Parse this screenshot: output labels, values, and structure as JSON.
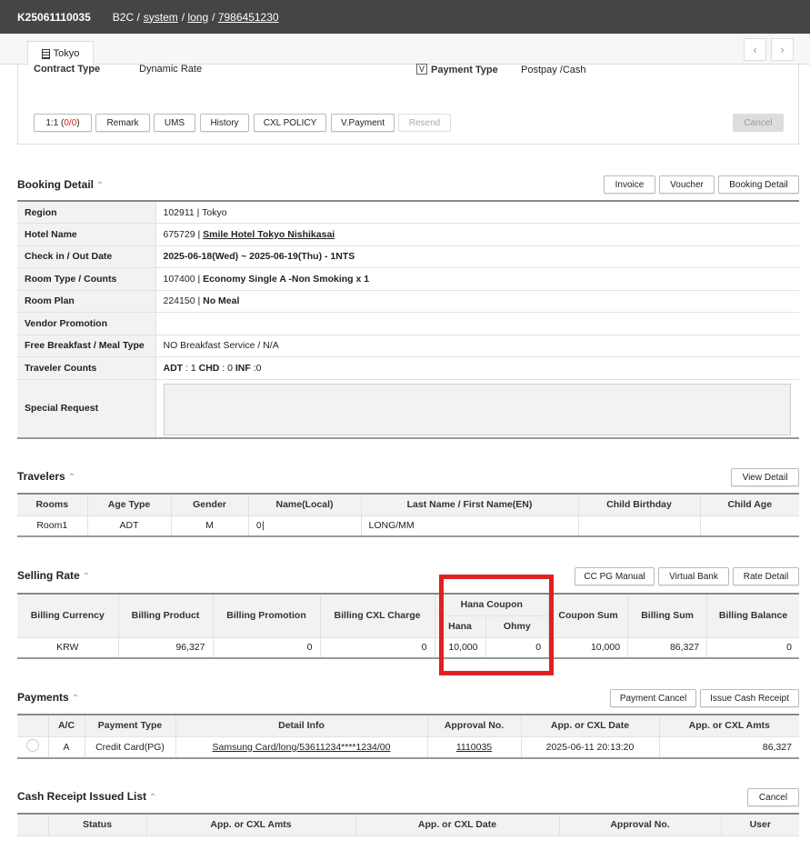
{
  "header": {
    "booking_id": "K25061110035",
    "channel": "B2C /",
    "crumbs": [
      "system",
      "long",
      "7986451230"
    ]
  },
  "tab": {
    "label": "Tokyo",
    "icon": "building-icon"
  },
  "nav": {
    "prev": "‹",
    "next": "›"
  },
  "contract": {
    "contract_type_label": "Contract Type",
    "contract_type": "Dynamic Rate",
    "v_badge": "V",
    "payment_type_label": "Payment Type",
    "payment_type": "Postpay /Cash"
  },
  "actions": {
    "one_to_one": "1:1 (",
    "oto_count": "0/0",
    "oto_close": ")",
    "remark": "Remark",
    "ums": "UMS",
    "history": "History",
    "cxl_policy": "CXL POLICY",
    "v_payment": "V.Payment",
    "resend": "Resend",
    "cancel": "Cancel"
  },
  "booking_detail": {
    "title": "Booking Detail",
    "buttons": [
      "Invoice",
      "Voucher",
      "Booking Detail"
    ],
    "rows": [
      {
        "label": "Region",
        "code": "102911 | ",
        "value": "Tokyo",
        "bold": false
      },
      {
        "label": "Hotel Name",
        "code": "675729 | ",
        "value": "Smile Hotel Tokyo Nishikasai",
        "bold": true
      },
      {
        "label": "Check in / Out Date",
        "code": "",
        "value": "2025-06-18(Wed) ~ 2025-06-19(Thu) - 1NTS",
        "bold": true
      },
      {
        "label": "Room Type / Counts",
        "code": "107400 | ",
        "value": "Economy Single A -Non Smoking x 1",
        "bold": true
      },
      {
        "label": "Room Plan",
        "code": "224150 | ",
        "value": "No Meal",
        "bold": true
      },
      {
        "label": "Vendor Promotion",
        "code": "",
        "value": "",
        "bold": false
      },
      {
        "label": "Free Breakfast / Meal Type",
        "code": "",
        "value": "NO Breakfast Service / N/A",
        "bold": false
      }
    ],
    "traveler_counts_label": "Traveler Counts",
    "adt_label": "ADT",
    "adt": " : 1 ",
    "chd_label": "CHD",
    "chd": " : 0 ",
    "inf_label": "INF",
    "inf": " :0",
    "special_request_label": "Special Request",
    "special_request": ""
  },
  "travelers": {
    "title": "Travelers",
    "view_detail": "View Detail",
    "headers": [
      "Rooms",
      "Age Type",
      "Gender",
      "Name(Local)",
      "Last Name / First Name(EN)",
      "Child Birthday",
      "Child Age"
    ],
    "rows": [
      [
        "Room1",
        "ADT",
        "M",
        "이",
        "LONG/MM",
        "",
        ""
      ]
    ]
  },
  "selling_rate": {
    "title": "Selling Rate",
    "buttons": [
      "CC PG Manual",
      "Virtual Bank",
      "Rate Detail"
    ],
    "headers": {
      "billing_currency": "Billing Currency",
      "billing_product": "Billing Product",
      "billing_promotion": "Billing Promotion",
      "billing_cxl_charge": "Billing CXL Charge",
      "hana_coupon": "Hana Coupon",
      "hana": "Hana",
      "ohmy": "Ohmy",
      "coupon_sum": "Coupon Sum",
      "billing_sum": "Billing Sum",
      "billing_balance": "Billing Balance"
    },
    "row": {
      "billing_currency": "KRW",
      "billing_product": "96,327",
      "billing_promotion": "0",
      "billing_cxl_charge": "0",
      "hana": "10,000",
      "ohmy": "0",
      "coupon_sum": "10,000",
      "billing_sum": "86,327",
      "billing_balance": "0"
    },
    "highlight_color": "#e02020"
  },
  "payments": {
    "title": "Payments",
    "buttons": [
      "Payment Cancel",
      "Issue Cash Receipt"
    ],
    "headers": [
      "",
      "A/C",
      "Payment Type",
      "Detail Info",
      "Approval No.",
      "App. or CXL Date",
      "App. or CXL Amts"
    ],
    "row": {
      "ac": "A",
      "payment_type": "Credit Card(PG)",
      "detail": "Samsung Card/long/53611234****1234/00",
      "approval": "1110035",
      "date": "2025-06-11 20:13:20",
      "amount": "86,327"
    }
  },
  "cash_receipt": {
    "title": "Cash Receipt Issued List",
    "cancel": "Cancel",
    "headers": [
      "",
      "Status",
      "App. or CXL Amts",
      "App. or CXL Date",
      "Approval No.",
      "User"
    ]
  }
}
